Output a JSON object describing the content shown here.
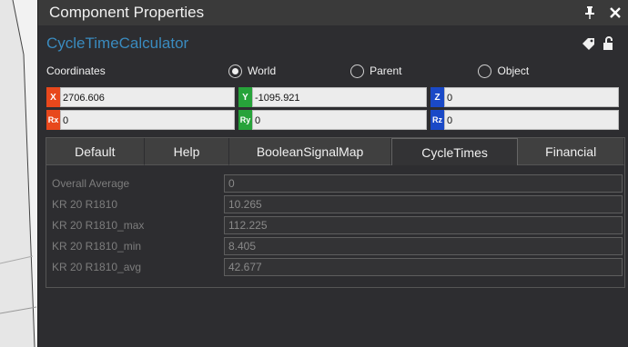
{
  "window": {
    "title": "Component Properties",
    "pin_icon": "pin-icon",
    "close_icon": "close-icon"
  },
  "component": {
    "name": "CycleTimeCalculator",
    "tag_icon": "tag-icon",
    "lock_icon": "unlock-icon"
  },
  "coordinates": {
    "label": "Coordinates",
    "options": [
      {
        "label": "World",
        "selected": true
      },
      {
        "label": "Parent",
        "selected": false
      },
      {
        "label": "Object",
        "selected": false
      }
    ]
  },
  "fields": {
    "x": {
      "tag": "X",
      "value": "2706.606"
    },
    "y": {
      "tag": "Y",
      "value": "-1095.921"
    },
    "z": {
      "tag": "Z",
      "value": "0"
    },
    "rx": {
      "tag": "Rx",
      "value": "0"
    },
    "ry": {
      "tag": "Ry",
      "value": "0"
    },
    "rz": {
      "tag": "Rz",
      "value": "0"
    }
  },
  "colors": {
    "x_tag": "#e8481c",
    "y_tag": "#27a33a",
    "z_tag": "#1a49c7",
    "component_name": "#3a8bbf"
  },
  "tabs": [
    {
      "label": "Default",
      "active": false
    },
    {
      "label": "Help",
      "active": false
    },
    {
      "label": "BooleanSignalMap",
      "active": false
    },
    {
      "label": "CycleTimes",
      "active": true
    },
    {
      "label": "Financial",
      "active": false
    }
  ],
  "properties": [
    {
      "label": "Overall Average",
      "value": "0"
    },
    {
      "label": "KR 20 R1810",
      "value": "10.265"
    },
    {
      "label": "KR 20 R1810_max",
      "value": "112.225"
    },
    {
      "label": "KR 20 R1810_min",
      "value": "8.405"
    },
    {
      "label": "KR 20 R1810_avg",
      "value": "42.677"
    }
  ]
}
